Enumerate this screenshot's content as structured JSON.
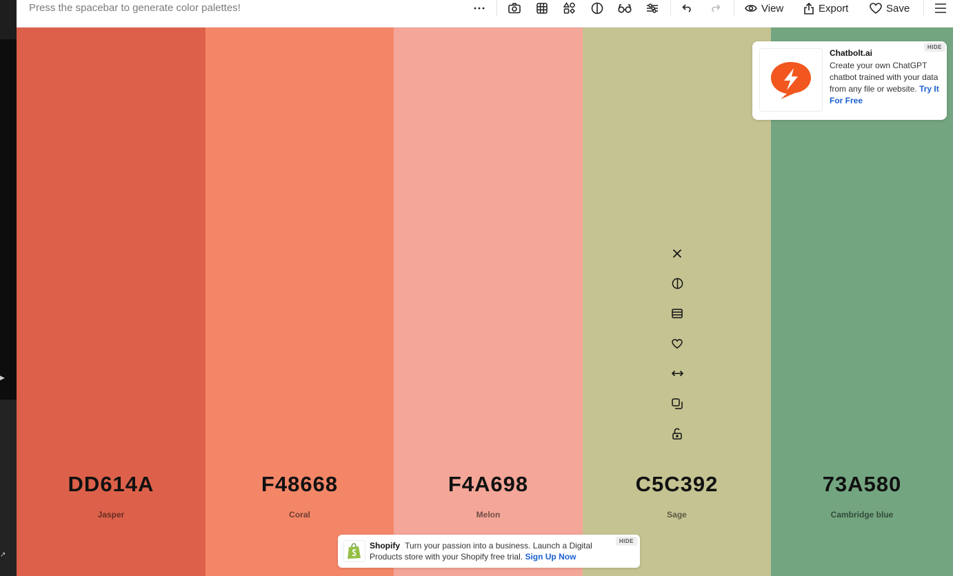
{
  "toolbar": {
    "hint": "Press the spacebar to generate color palettes!",
    "icons": [
      "more-dots-icon",
      "camera-icon",
      "grid-icon",
      "shapes-icon",
      "contrast-icon",
      "glasses-icon",
      "sliders-icon",
      "undo-icon",
      "redo-icon"
    ],
    "view_label": "View",
    "export_label": "Export",
    "save_label": "Save"
  },
  "palette": {
    "colors": [
      {
        "hex": "DD614A",
        "name": "Jasper",
        "color": "#DD614A"
      },
      {
        "hex": "F48668",
        "name": "Coral",
        "color": "#F48668"
      },
      {
        "hex": "F4A698",
        "name": "Melon",
        "color": "#F4A698"
      },
      {
        "hex": "C5C392",
        "name": "Sage",
        "color": "#C5C392"
      },
      {
        "hex": "73A580",
        "name": "Cambridge blue",
        "color": "#73A580"
      }
    ],
    "column_tools": [
      "close-icon",
      "contrast-icon",
      "shades-icon",
      "heart-icon",
      "drag-arrows-icon",
      "copy-icon",
      "unlock-icon"
    ]
  },
  "ad": {
    "title": "Chatbolt.ai",
    "description": "Create your own ChatGPT chatbot trained with your data from any file or website.",
    "cta": "Try It For Free",
    "hide": "HIDE",
    "logo_color": "#F1571E"
  },
  "banner": {
    "brand": "Shopify",
    "text": "Turn your passion into a business. Launch a Digital Products store with your Shopify free trial.",
    "cta": "Sign Up Now",
    "hide": "HIDE",
    "logo_color": "#95BF47"
  }
}
